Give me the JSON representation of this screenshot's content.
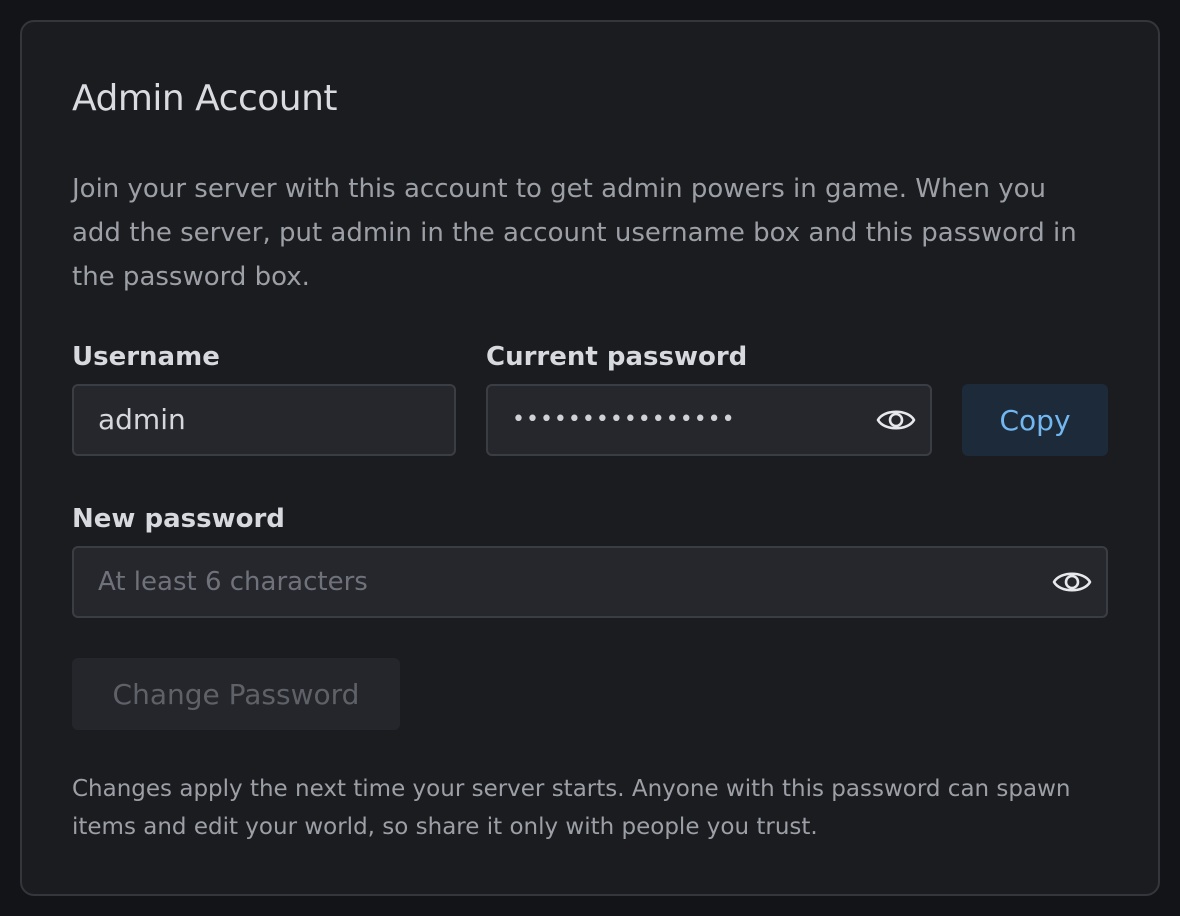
{
  "card": {
    "title": "Admin Account",
    "description": "Join your server with this account to get admin powers in game. When you add the server, put admin in the account username box and this password in the password box."
  },
  "username": {
    "label": "Username",
    "value": "admin"
  },
  "current_password": {
    "label": "Current password",
    "masked_value": "••••••••••••••••",
    "toggle_icon": "eye-icon"
  },
  "copy_button": {
    "label": "Copy"
  },
  "new_password": {
    "label": "New password",
    "placeholder": "At least 6 characters",
    "toggle_icon": "eye-icon"
  },
  "change_button": {
    "label": "Change Password",
    "state": "disabled"
  },
  "footnote": "Changes apply the next time your server starts. Anyone with this password can spawn items and edit your world, so share it only with people you trust.",
  "colors": {
    "background": "#131417",
    "card": "#1b1c20",
    "accent": "#72b7f0",
    "copy_button_bg": "#1d2a3a"
  }
}
